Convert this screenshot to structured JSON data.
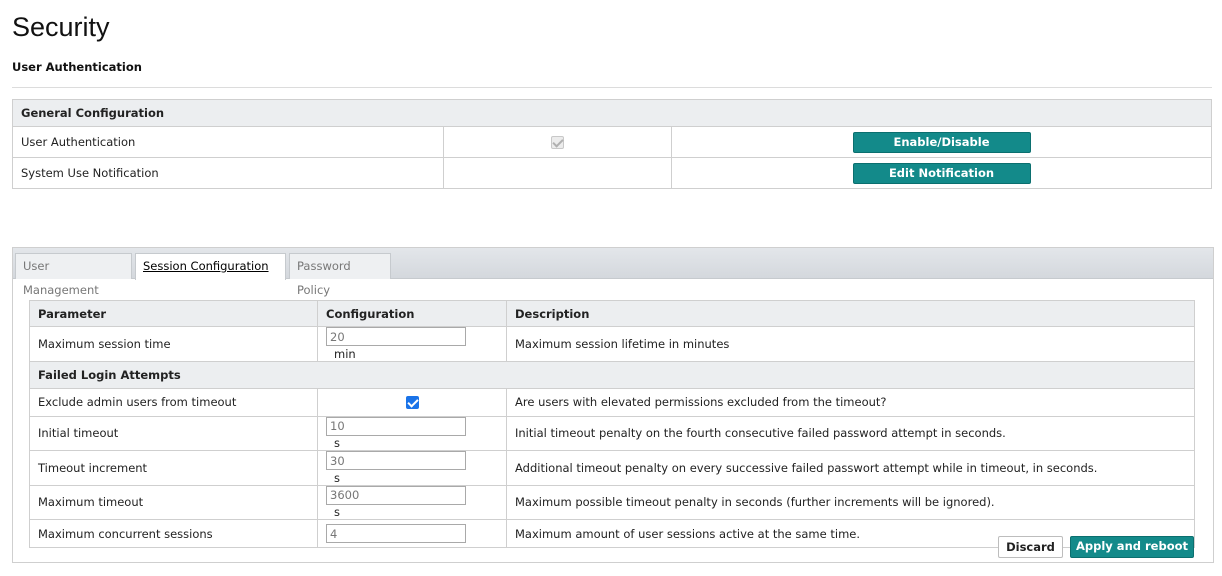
{
  "page": {
    "title": "Security",
    "subtitle": "User Authentication"
  },
  "general": {
    "header": "General Configuration",
    "rows": [
      {
        "label": "User Authentication",
        "checked": true,
        "button": "Enable/Disable"
      },
      {
        "label": "System Use Notification",
        "button": "Edit Notification"
      }
    ]
  },
  "tabs": [
    {
      "label": "User Management",
      "active": false
    },
    {
      "label": "Session Configuration",
      "active": true
    },
    {
      "label": "Password Policy",
      "active": false
    }
  ],
  "session": {
    "columns": [
      "Parameter",
      "Configuration",
      "Description"
    ],
    "rows": [
      {
        "param": "Maximum session time",
        "value": "20",
        "unit": "min",
        "description": "Maximum session lifetime in minutes"
      }
    ],
    "group_label": "Failed Login Attempts",
    "group_rows": [
      {
        "param": "Exclude admin users from timeout",
        "checkbox": true,
        "description": "Are users with elevated permissions excluded from the timeout?"
      },
      {
        "param": "Initial timeout",
        "value": "10",
        "unit": "s",
        "description": "Initial timeout penalty on the fourth consecutive failed password attempt in seconds."
      },
      {
        "param": "Timeout increment",
        "value": "30",
        "unit": "s",
        "description": "Additional timeout penalty on every successive failed passwort attempt while in timeout, in seconds."
      },
      {
        "param": "Maximum timeout",
        "value": "3600",
        "unit": "s",
        "description": "Maximum possible timeout penalty in seconds (further increments will be ignored)."
      },
      {
        "param": "Maximum concurrent sessions",
        "value": "4",
        "unit": "",
        "description": "Maximum amount of user sessions active at the same time."
      }
    ]
  },
  "actions": {
    "discard": "Discard",
    "apply": "Apply and reboot"
  },
  "colors": {
    "accent": "#138a8a",
    "header_bg": "#eceef0",
    "checkbox_on": "#1a73e8"
  }
}
